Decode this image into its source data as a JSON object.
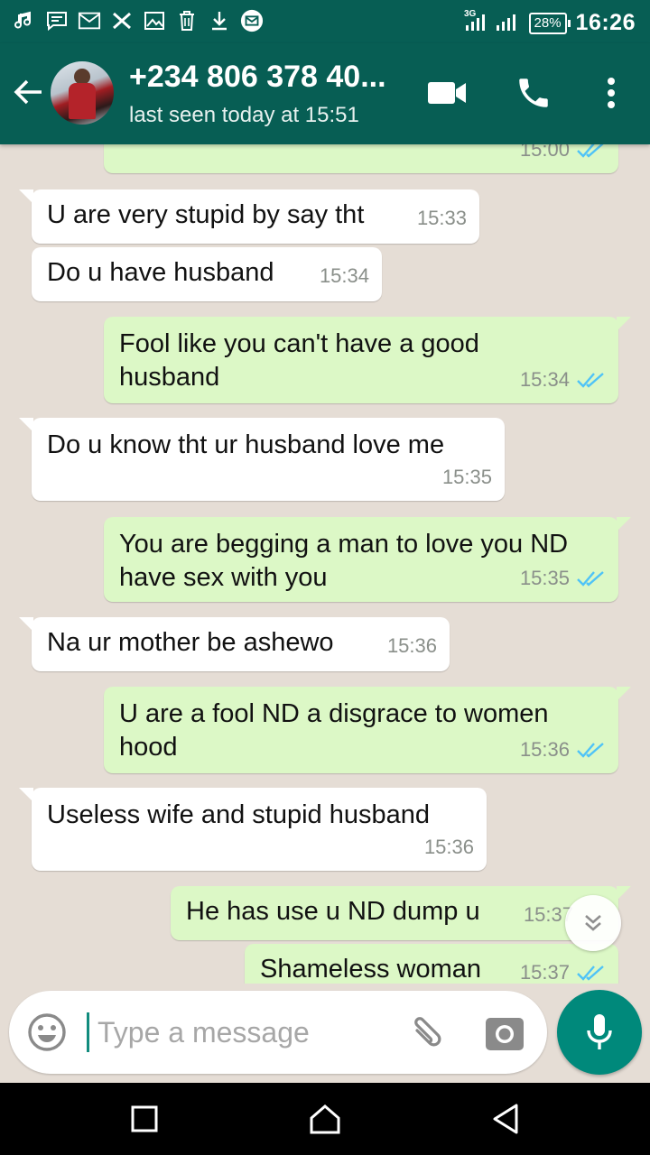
{
  "status_bar": {
    "time": "16:26",
    "battery": "28%",
    "network": "3G",
    "notification_icons": [
      "music-icon",
      "message-icon",
      "gmail-icon",
      "x-icon",
      "image-icon",
      "trash-icon",
      "download-icon",
      "mail-badge-icon"
    ]
  },
  "header": {
    "contact": "+234 806 378 40...",
    "last_seen": "last seen today at 15:51",
    "icons": [
      "back-arrow-icon",
      "avatar",
      "video-call-icon",
      "voice-call-icon",
      "more-options-icon"
    ]
  },
  "messages": [
    {
      "dir": "out",
      "text": "",
      "time": "15:00",
      "ticks": true
    },
    {
      "dir": "in",
      "text": "U are very stupid by say tht",
      "time": "15:33"
    },
    {
      "dir": "in",
      "text": "Do u have husband",
      "time": "15:34"
    },
    {
      "dir": "out",
      "text": "Fool like you can't have a good husband",
      "time": "15:34",
      "ticks": true
    },
    {
      "dir": "in",
      "text": "Do u know tht ur husband  love me",
      "time": "15:35"
    },
    {
      "dir": "out",
      "text": "You are begging a man to love you ND have sex with you",
      "time": "15:35",
      "ticks": true
    },
    {
      "dir": "in",
      "text": "Na ur mother be ashewo",
      "time": "15:36"
    },
    {
      "dir": "out",
      "text": "U are a fool ND a disgrace to women hood",
      "time": "15:36",
      "ticks": true
    },
    {
      "dir": "in",
      "text": "Useless wife and stupid husband",
      "time": "15:36"
    },
    {
      "dir": "out",
      "text": "He has use u ND dump u",
      "time": "15:37",
      "ticks": false
    },
    {
      "dir": "out",
      "text": "Shameless woman",
      "time": "15:37",
      "ticks": true
    }
  ],
  "composer": {
    "placeholder": "Type a message",
    "value": ""
  },
  "colors": {
    "header": "#075e54",
    "incoming_bubble": "#ffffff",
    "outgoing_bubble": "#dcf8c6",
    "chat_background": "#e5ddd5",
    "mic_button": "#00897b",
    "read_ticks": "#4fc3f7"
  }
}
